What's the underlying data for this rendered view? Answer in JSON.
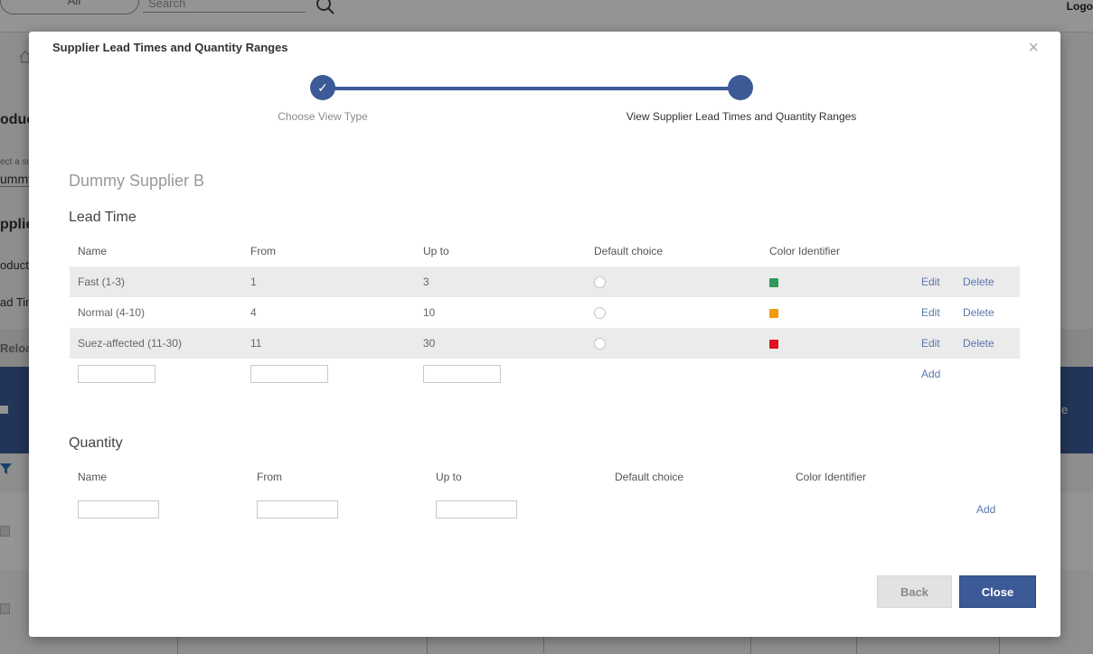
{
  "background": {
    "scope_label": "All",
    "search_placeholder": "Search",
    "logo_text": "Logo",
    "page_heading_fragment": "oduc",
    "select_hint_fragment": "ect a su",
    "select_value_fragment": "ummy",
    "section_fragment": "pplie",
    "row1_fragment": "oduct",
    "row2_fragment": "ad Tim",
    "reload_fragment": "Reloa",
    "table_header_fragment": "e"
  },
  "modal": {
    "title": "Supplier Lead Times and Quantity Ranges",
    "close_symbol": "×",
    "steps": [
      {
        "label": "Choose View Type",
        "icon": "check-icon",
        "symbol": "✓",
        "state": "done"
      },
      {
        "label": "View Supplier Lead Times and Quantity Ranges",
        "state": "active"
      }
    ],
    "supplier_name": "Dummy Supplier B",
    "lead_time": {
      "title": "Lead Time",
      "columns": [
        "Name",
        "From",
        "Up to",
        "Default choice",
        "Color Identifier"
      ],
      "rows": [
        {
          "name": "Fast (1-3)",
          "from": "1",
          "up_to": "3",
          "color": "#2e9b5a",
          "edit": "Edit",
          "delete": "Delete"
        },
        {
          "name": "Normal (4-10)",
          "from": "4",
          "up_to": "10",
          "color": "#f29b0c",
          "edit": "Edit",
          "delete": "Delete"
        },
        {
          "name": "Suez-affected (11-30)",
          "from": "11",
          "up_to": "30",
          "color": "#e0101e",
          "edit": "Edit",
          "delete": "Delete"
        }
      ],
      "add_label": "Add"
    },
    "quantity": {
      "title": "Quantity",
      "columns": [
        "Name",
        "From",
        "Up to",
        "Default choice",
        "Color Identifier"
      ],
      "add_label": "Add"
    },
    "buttons": {
      "back": "Back",
      "close": "Close"
    }
  },
  "colors": {
    "primary": "#3b5a96",
    "link": "#5b77ad",
    "row_shade": "#ebebeb"
  }
}
